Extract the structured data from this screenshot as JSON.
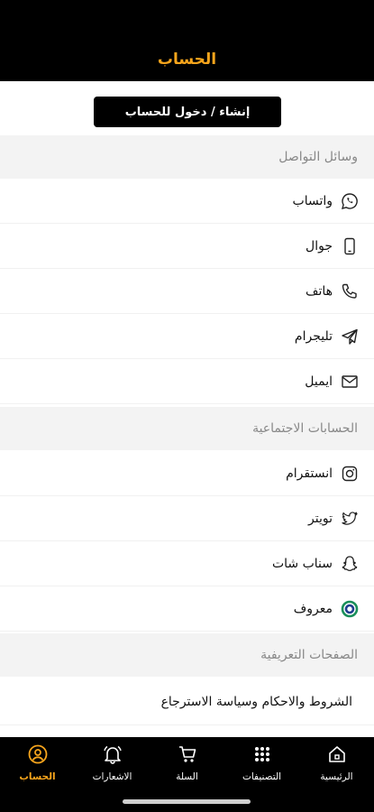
{
  "header": {
    "title": "الحساب"
  },
  "login": {
    "label": "إنشاء / دخول للحساب"
  },
  "contact": {
    "title": "وسائل التواصل",
    "items": [
      {
        "label": "واتساب",
        "icon": "whatsapp-icon"
      },
      {
        "label": "جوال",
        "icon": "mobile-phone-icon"
      },
      {
        "label": "هاتف",
        "icon": "phone-icon"
      },
      {
        "label": "تليجرام",
        "icon": "telegram-icon"
      },
      {
        "label": "ايميل",
        "icon": "email-icon"
      }
    ]
  },
  "social": {
    "title": "الحسابات الاجتماعية",
    "items": [
      {
        "label": "انستقرام",
        "icon": "instagram-icon"
      },
      {
        "label": "تويتر",
        "icon": "twitter-icon"
      },
      {
        "label": "سناب شات",
        "icon": "snapchat-icon"
      },
      {
        "label": "معروف",
        "icon": "maroof-icon"
      }
    ]
  },
  "pages": {
    "title": "الصفحات التعريفية",
    "items": [
      {
        "label": "الشروط والاحكام وسياسة الاسترجاع"
      }
    ]
  },
  "tabbar": {
    "tabs": [
      {
        "label": "الرئيسية",
        "icon": "home-icon"
      },
      {
        "label": "التصنيفات",
        "icon": "grid-icon"
      },
      {
        "label": "السلة",
        "icon": "cart-icon"
      },
      {
        "label": "الاشعارات",
        "icon": "bell-icon"
      },
      {
        "label": "الحساب",
        "icon": "account-icon",
        "active": true
      }
    ]
  },
  "colors": {
    "accent": "#f7a51c",
    "header_bg": "#000000",
    "section_bg": "#f3f3f3"
  }
}
